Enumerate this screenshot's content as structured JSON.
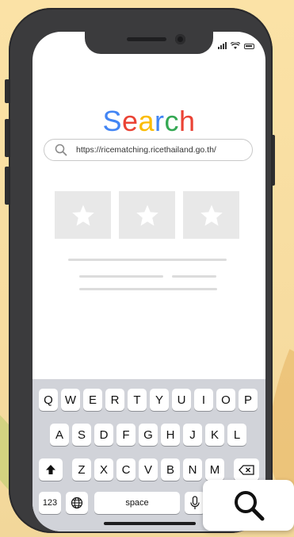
{
  "browser": {
    "title_letters": [
      {
        "char": "S",
        "color": "#4285F4"
      },
      {
        "char": "e",
        "color": "#EA4335"
      },
      {
        "char": "a",
        "color": "#FBBC05"
      },
      {
        "char": "r",
        "color": "#4285F4"
      },
      {
        "char": "c",
        "color": "#34A853"
      },
      {
        "char": "h",
        "color": "#EA4335"
      }
    ],
    "url": "https://ricematching.ricethailand.go.th/",
    "search_icon": "search-icon",
    "result_icon": "star-icon"
  },
  "keyboard": {
    "row1": [
      "Q",
      "W",
      "E",
      "R",
      "T",
      "Y",
      "U",
      "I",
      "O",
      "P"
    ],
    "row2": [
      "A",
      "S",
      "D",
      "F",
      "G",
      "H",
      "J",
      "K",
      "L"
    ],
    "row3": [
      "Z",
      "X",
      "C",
      "V",
      "B",
      "N",
      "M"
    ],
    "shift_icon": "shift-arrow-icon",
    "delete_icon": "backspace-icon",
    "numbers_label": "123",
    "globe_icon": "globe-icon",
    "space_label": "space",
    "mic_icon": "microphone-icon"
  },
  "search_button": {
    "icon": "search-icon"
  },
  "colors": {
    "background": "#F9E0A4",
    "phone_frame": "#3B3B3D",
    "keyboard_bg": "#D1D3D9",
    "placeholder_gray": "#E8E8E8"
  }
}
